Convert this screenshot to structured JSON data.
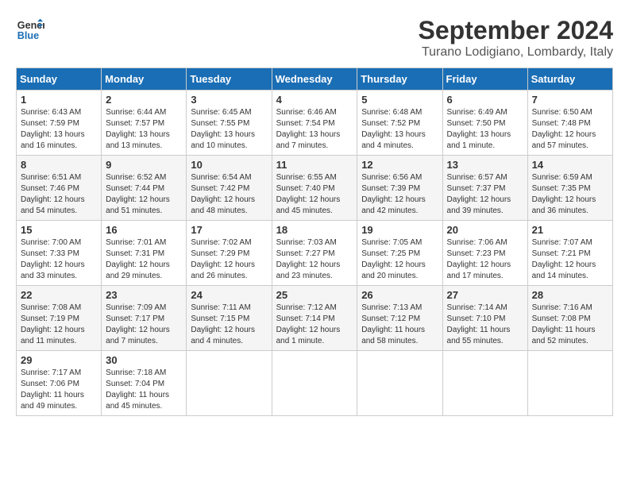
{
  "header": {
    "logo_line1": "General",
    "logo_line2": "Blue",
    "month_year": "September 2024",
    "location": "Turano Lodigiano, Lombardy, Italy"
  },
  "weekdays": [
    "Sunday",
    "Monday",
    "Tuesday",
    "Wednesday",
    "Thursday",
    "Friday",
    "Saturday"
  ],
  "weeks": [
    [
      {
        "day": "1",
        "lines": [
          "Sunrise: 6:43 AM",
          "Sunset: 7:59 PM",
          "Daylight: 13 hours",
          "and 16 minutes."
        ]
      },
      {
        "day": "2",
        "lines": [
          "Sunrise: 6:44 AM",
          "Sunset: 7:57 PM",
          "Daylight: 13 hours",
          "and 13 minutes."
        ]
      },
      {
        "day": "3",
        "lines": [
          "Sunrise: 6:45 AM",
          "Sunset: 7:55 PM",
          "Daylight: 13 hours",
          "and 10 minutes."
        ]
      },
      {
        "day": "4",
        "lines": [
          "Sunrise: 6:46 AM",
          "Sunset: 7:54 PM",
          "Daylight: 13 hours",
          "and 7 minutes."
        ]
      },
      {
        "day": "5",
        "lines": [
          "Sunrise: 6:48 AM",
          "Sunset: 7:52 PM",
          "Daylight: 13 hours",
          "and 4 minutes."
        ]
      },
      {
        "day": "6",
        "lines": [
          "Sunrise: 6:49 AM",
          "Sunset: 7:50 PM",
          "Daylight: 13 hours",
          "and 1 minute."
        ]
      },
      {
        "day": "7",
        "lines": [
          "Sunrise: 6:50 AM",
          "Sunset: 7:48 PM",
          "Daylight: 12 hours",
          "and 57 minutes."
        ]
      }
    ],
    [
      {
        "day": "8",
        "lines": [
          "Sunrise: 6:51 AM",
          "Sunset: 7:46 PM",
          "Daylight: 12 hours",
          "and 54 minutes."
        ]
      },
      {
        "day": "9",
        "lines": [
          "Sunrise: 6:52 AM",
          "Sunset: 7:44 PM",
          "Daylight: 12 hours",
          "and 51 minutes."
        ]
      },
      {
        "day": "10",
        "lines": [
          "Sunrise: 6:54 AM",
          "Sunset: 7:42 PM",
          "Daylight: 12 hours",
          "and 48 minutes."
        ]
      },
      {
        "day": "11",
        "lines": [
          "Sunrise: 6:55 AM",
          "Sunset: 7:40 PM",
          "Daylight: 12 hours",
          "and 45 minutes."
        ]
      },
      {
        "day": "12",
        "lines": [
          "Sunrise: 6:56 AM",
          "Sunset: 7:39 PM",
          "Daylight: 12 hours",
          "and 42 minutes."
        ]
      },
      {
        "day": "13",
        "lines": [
          "Sunrise: 6:57 AM",
          "Sunset: 7:37 PM",
          "Daylight: 12 hours",
          "and 39 minutes."
        ]
      },
      {
        "day": "14",
        "lines": [
          "Sunrise: 6:59 AM",
          "Sunset: 7:35 PM",
          "Daylight: 12 hours",
          "and 36 minutes."
        ]
      }
    ],
    [
      {
        "day": "15",
        "lines": [
          "Sunrise: 7:00 AM",
          "Sunset: 7:33 PM",
          "Daylight: 12 hours",
          "and 33 minutes."
        ]
      },
      {
        "day": "16",
        "lines": [
          "Sunrise: 7:01 AM",
          "Sunset: 7:31 PM",
          "Daylight: 12 hours",
          "and 29 minutes."
        ]
      },
      {
        "day": "17",
        "lines": [
          "Sunrise: 7:02 AM",
          "Sunset: 7:29 PM",
          "Daylight: 12 hours",
          "and 26 minutes."
        ]
      },
      {
        "day": "18",
        "lines": [
          "Sunrise: 7:03 AM",
          "Sunset: 7:27 PM",
          "Daylight: 12 hours",
          "and 23 minutes."
        ]
      },
      {
        "day": "19",
        "lines": [
          "Sunrise: 7:05 AM",
          "Sunset: 7:25 PM",
          "Daylight: 12 hours",
          "and 20 minutes."
        ]
      },
      {
        "day": "20",
        "lines": [
          "Sunrise: 7:06 AM",
          "Sunset: 7:23 PM",
          "Daylight: 12 hours",
          "and 17 minutes."
        ]
      },
      {
        "day": "21",
        "lines": [
          "Sunrise: 7:07 AM",
          "Sunset: 7:21 PM",
          "Daylight: 12 hours",
          "and 14 minutes."
        ]
      }
    ],
    [
      {
        "day": "22",
        "lines": [
          "Sunrise: 7:08 AM",
          "Sunset: 7:19 PM",
          "Daylight: 12 hours",
          "and 11 minutes."
        ]
      },
      {
        "day": "23",
        "lines": [
          "Sunrise: 7:09 AM",
          "Sunset: 7:17 PM",
          "Daylight: 12 hours",
          "and 7 minutes."
        ]
      },
      {
        "day": "24",
        "lines": [
          "Sunrise: 7:11 AM",
          "Sunset: 7:15 PM",
          "Daylight: 12 hours",
          "and 4 minutes."
        ]
      },
      {
        "day": "25",
        "lines": [
          "Sunrise: 7:12 AM",
          "Sunset: 7:14 PM",
          "Daylight: 12 hours",
          "and 1 minute."
        ]
      },
      {
        "day": "26",
        "lines": [
          "Sunrise: 7:13 AM",
          "Sunset: 7:12 PM",
          "Daylight: 11 hours",
          "and 58 minutes."
        ]
      },
      {
        "day": "27",
        "lines": [
          "Sunrise: 7:14 AM",
          "Sunset: 7:10 PM",
          "Daylight: 11 hours",
          "and 55 minutes."
        ]
      },
      {
        "day": "28",
        "lines": [
          "Sunrise: 7:16 AM",
          "Sunset: 7:08 PM",
          "Daylight: 11 hours",
          "and 52 minutes."
        ]
      }
    ],
    [
      {
        "day": "29",
        "lines": [
          "Sunrise: 7:17 AM",
          "Sunset: 7:06 PM",
          "Daylight: 11 hours",
          "and 49 minutes."
        ]
      },
      {
        "day": "30",
        "lines": [
          "Sunrise: 7:18 AM",
          "Sunset: 7:04 PM",
          "Daylight: 11 hours",
          "and 45 minutes."
        ]
      },
      {
        "day": "",
        "lines": []
      },
      {
        "day": "",
        "lines": []
      },
      {
        "day": "",
        "lines": []
      },
      {
        "day": "",
        "lines": []
      },
      {
        "day": "",
        "lines": []
      }
    ]
  ]
}
